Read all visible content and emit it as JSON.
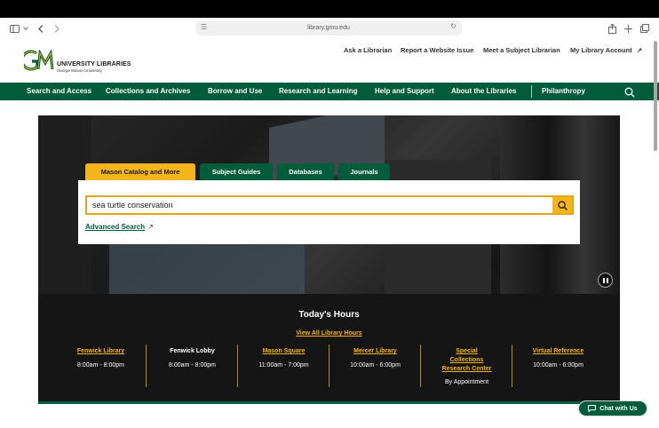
{
  "browser": {
    "url": "library.gmu.edu",
    "icons": [
      "sidebar-icon",
      "chevron-down-icon",
      "back-icon",
      "forward-icon",
      "reader-icon",
      "reload-icon",
      "share-icon",
      "new-tab-icon",
      "tabs-icon"
    ]
  },
  "header": {
    "logo_mark": "GM",
    "logo_line1": "UNIVERSITY LIBRARIES",
    "logo_line2": "George Mason University",
    "utility_links": [
      {
        "label": "Ask a Librarian"
      },
      {
        "label": "Report a Website Issue"
      },
      {
        "label": "Meet a Subject Librarian"
      },
      {
        "label": "My Library Account",
        "icon": "external-link-icon"
      }
    ]
  },
  "nav": {
    "items": [
      {
        "label": "Search and Access"
      },
      {
        "label": "Collections and Archives"
      },
      {
        "label": "Borrow and Use"
      },
      {
        "label": "Research and Learning"
      },
      {
        "label": "Help and Support"
      },
      {
        "label": "About the Libraries"
      },
      {
        "label": "Philanthropy"
      }
    ],
    "search_icon": "search-icon"
  },
  "search": {
    "tabs": [
      {
        "label": "Mason Catalog and More",
        "active": true
      },
      {
        "label": "Subject Guides",
        "active": false
      },
      {
        "label": "Databases",
        "active": false
      },
      {
        "label": "Journals",
        "active": false
      }
    ],
    "query": "sea turtle conservation",
    "advanced_label": "Advanced Search",
    "advanced_icon": "external-link-icon",
    "button_icon": "search-icon"
  },
  "hours": {
    "title": "Today's Hours",
    "view_all": "View All Library Hours",
    "locations": [
      {
        "name": "Fenwick Library",
        "time": "8:00am - 8:00pm",
        "link": true
      },
      {
        "name": "Fenwick Lobby",
        "time": "8:00am - 8:00pm",
        "link": false
      },
      {
        "name": "Mason Square",
        "time": "11:00am - 7:00pm",
        "link": true
      },
      {
        "name": "Mercer Library",
        "time": "10:00am - 6:00pm",
        "link": true
      },
      {
        "name": "Special Collections Research Center",
        "time": "By Appointment",
        "link": true
      },
      {
        "name": "Virtual Reference",
        "time": "10:00am - 6:00pm",
        "link": true
      }
    ]
  },
  "hero": {
    "pause_icon": "pause-icon"
  },
  "chat": {
    "label": "Chat with Us",
    "icon": "chat-icon"
  },
  "colors": {
    "mason_green": "#005c3a",
    "mason_gold": "#f3b51b",
    "dark": "#151515"
  }
}
